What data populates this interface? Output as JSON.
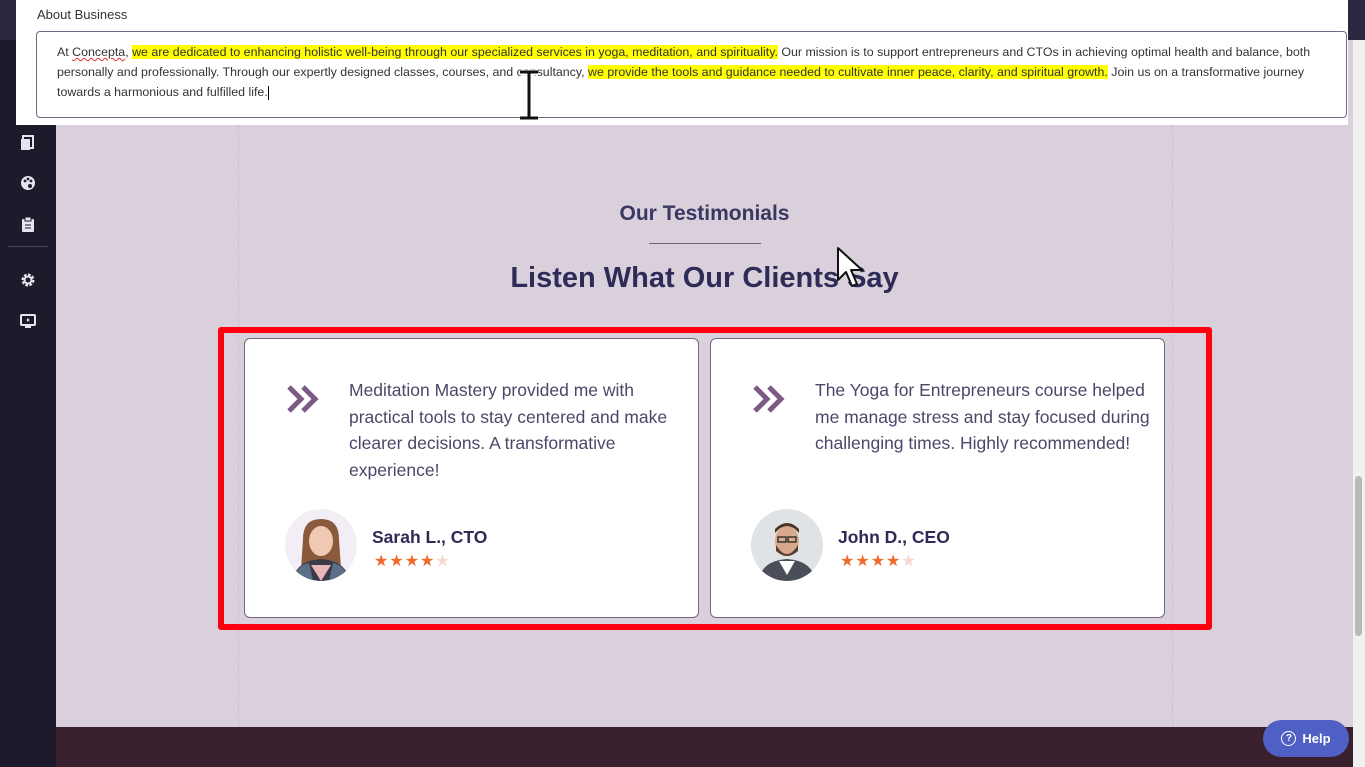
{
  "editor": {
    "label": "About Business",
    "text_parts": [
      "At ",
      "Concepta",
      ", ",
      "we are dedicated to enhancing holistic well-being through our specialized services in yoga, meditation, and spirituality.",
      " Our mission is to support entrepreneurs and CTOs in achieving optimal health and balance, both personally and professionally. Through our expertly designed classes, courses, and consultancy, ",
      "we provide the tools and guidance needed to cultivate inner peace, clarity, and spiritual growth.",
      " Join us on a transformative journey towards a harmonious and fulfilled life."
    ]
  },
  "testimonials": {
    "tagline": "Our Testimonials",
    "heading": "Listen What Our Clients Say",
    "items": [
      {
        "quote": "Meditation Mastery provided me with practical tools to stay centered and make clearer decisions. A transformative experience!",
        "author": "Sarah L., CTO",
        "rating": 4,
        "max_rating": 5
      },
      {
        "quote": "The Yoga for Entrepreneurs course helped me manage stress and stay focused during challenging times. Highly recommended!",
        "author": "John D., CEO",
        "rating": 4,
        "max_rating": 5
      }
    ]
  },
  "help_button": {
    "label": "Help"
  },
  "sidebar": {
    "icons": [
      "pages-icon",
      "palette-icon",
      "clipboard-icon",
      "settings-icon",
      "preview-icon"
    ]
  },
  "colors": {
    "accent": "#4f5fc4",
    "highlight_border": "#ff0010",
    "star": "#ef6a2c",
    "quote_icon": "#7b5a86"
  }
}
